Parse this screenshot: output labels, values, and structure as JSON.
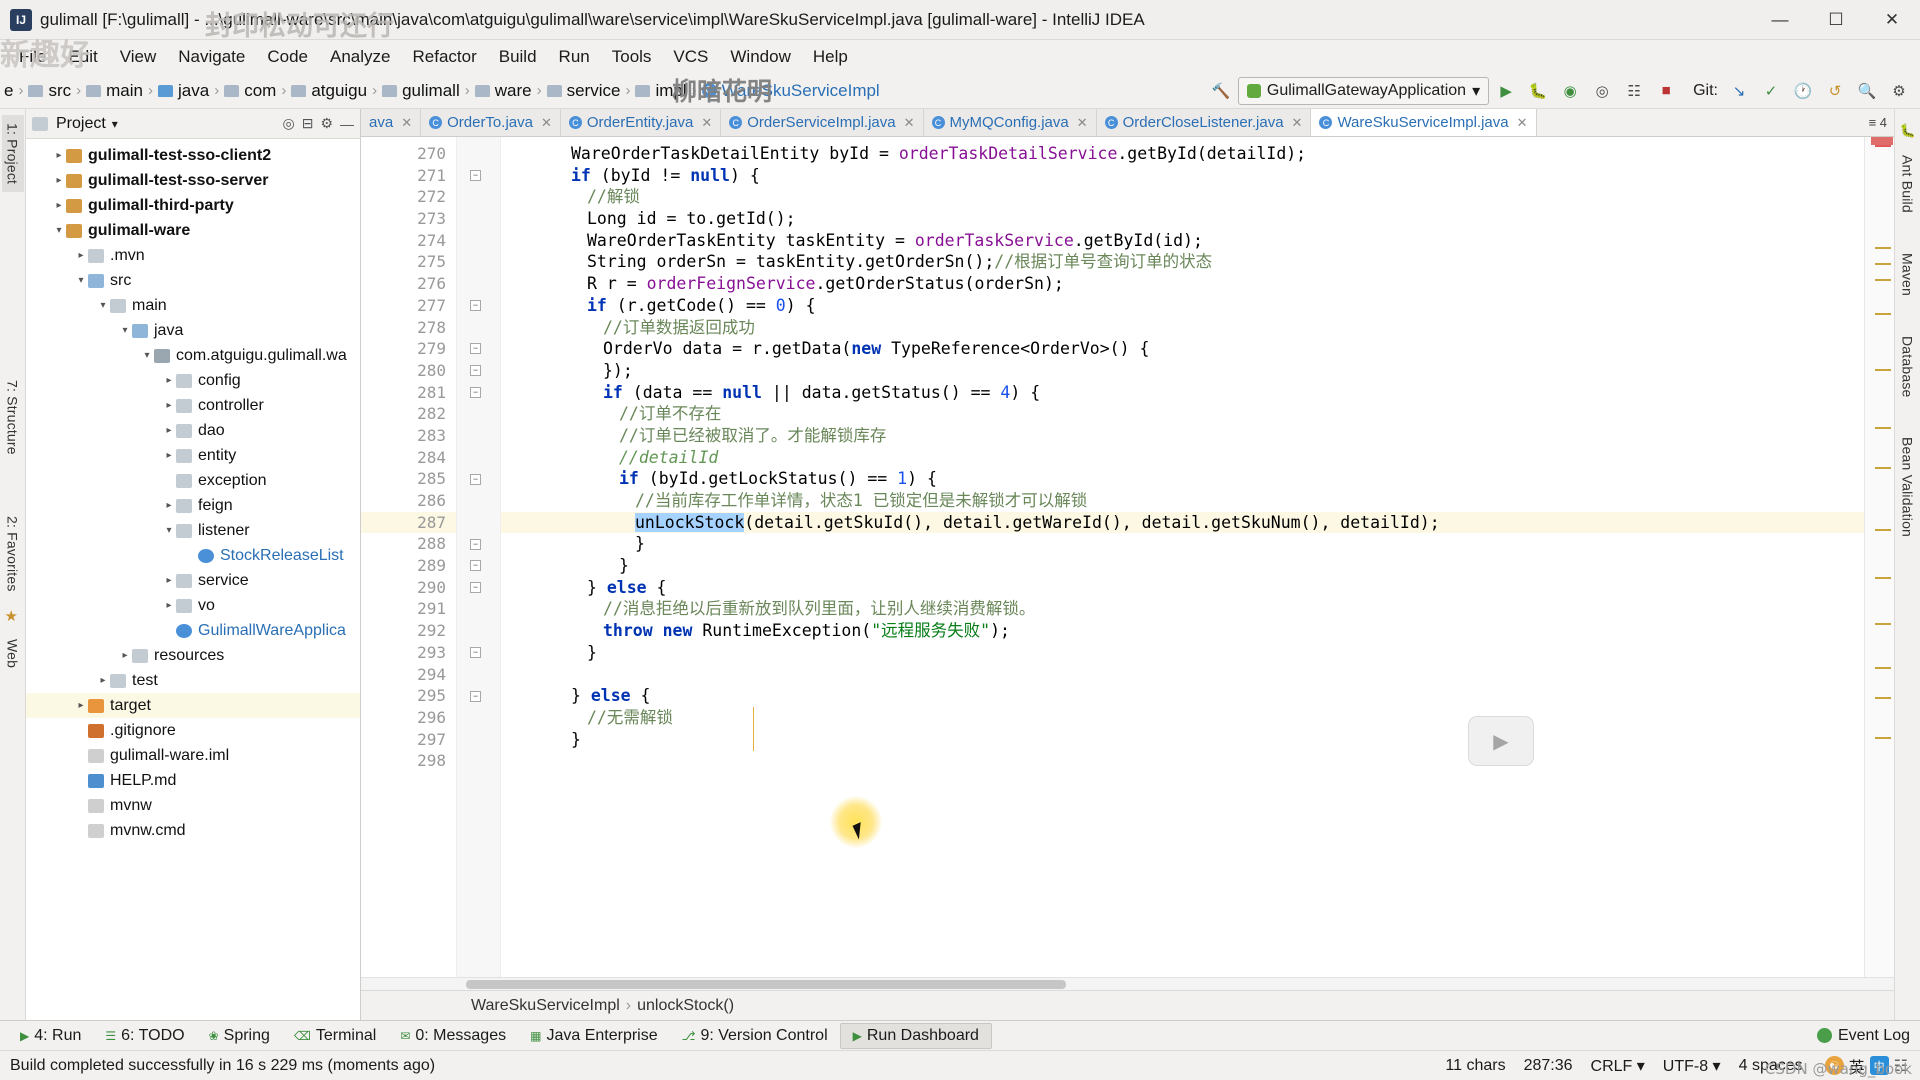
{
  "window": {
    "title": "gulimall [F:\\gulimall] - ...\\gulimall-ware\\src\\main\\java\\com\\atguigu\\gulimall\\ware\\service\\impl\\WareSkuServiceImpl.java [gulimall-ware] - IntelliJ IDEA",
    "app_icon": "IJ",
    "minimize": "—",
    "maximize": "☐",
    "close": "✕"
  },
  "menubar": [
    "File",
    "Edit",
    "View",
    "Navigate",
    "Code",
    "Analyze",
    "Refactor",
    "Build",
    "Run",
    "Tools",
    "VCS",
    "Window",
    "Help"
  ],
  "navbar": {
    "crumbs": [
      "e",
      "src",
      "main",
      "java",
      "com",
      "atguigu",
      "gulimall",
      "ware",
      "service",
      "impl",
      "WareSkuServiceImpl"
    ],
    "run_config": "GulimallGatewayApplication",
    "git_label": "Git:"
  },
  "project_panel": {
    "title": "Project",
    "tree": [
      {
        "indent": 1,
        "arrow": "›",
        "icon": "mod",
        "label": "gulimall-test-sso-client2",
        "bold": true,
        "selected": false
      },
      {
        "indent": 1,
        "arrow": "›",
        "icon": "mod",
        "label": "gulimall-test-sso-server",
        "bold": true,
        "selected": false
      },
      {
        "indent": 1,
        "arrow": "›",
        "icon": "mod",
        "label": "gulimall-third-party",
        "bold": true,
        "selected": false
      },
      {
        "indent": 1,
        "arrow": "⌄",
        "icon": "mod",
        "label": "gulimall-ware",
        "bold": true,
        "selected": false
      },
      {
        "indent": 2,
        "arrow": "›",
        "icon": "fold",
        "label": ".mvn",
        "bold": false,
        "selected": false
      },
      {
        "indent": 2,
        "arrow": "⌄",
        "icon": "src",
        "label": "src",
        "bold": false,
        "selected": false
      },
      {
        "indent": 3,
        "arrow": "⌄",
        "icon": "fold",
        "label": "main",
        "bold": false,
        "selected": false
      },
      {
        "indent": 4,
        "arrow": "⌄",
        "icon": "src",
        "label": "java",
        "bold": false,
        "selected": false
      },
      {
        "indent": 5,
        "arrow": "⌄",
        "icon": "pkg",
        "label": "com.atguigu.gulimall.wa",
        "bold": false,
        "selected": false
      },
      {
        "indent": 6,
        "arrow": "›",
        "icon": "fold",
        "label": "config",
        "bold": false,
        "selected": false
      },
      {
        "indent": 6,
        "arrow": "›",
        "icon": "fold",
        "label": "controller",
        "bold": false,
        "selected": false
      },
      {
        "indent": 6,
        "arrow": "›",
        "icon": "fold",
        "label": "dao",
        "bold": false,
        "selected": false
      },
      {
        "indent": 6,
        "arrow": "›",
        "icon": "fold",
        "label": "entity",
        "bold": false,
        "selected": false
      },
      {
        "indent": 6,
        "arrow": "",
        "icon": "fold",
        "label": "exception",
        "bold": false,
        "selected": false
      },
      {
        "indent": 6,
        "arrow": "›",
        "icon": "fold",
        "label": "feign",
        "bold": false,
        "selected": false
      },
      {
        "indent": 6,
        "arrow": "⌄",
        "icon": "fold",
        "label": "listener",
        "bold": false,
        "selected": false
      },
      {
        "indent": 7,
        "arrow": "",
        "icon": "java",
        "label": "StockReleaseList",
        "bold": false,
        "selected": false,
        "blue": true
      },
      {
        "indent": 6,
        "arrow": "›",
        "icon": "fold",
        "label": "service",
        "bold": false,
        "selected": false
      },
      {
        "indent": 6,
        "arrow": "›",
        "icon": "fold",
        "label": "vo",
        "bold": false,
        "selected": false
      },
      {
        "indent": 6,
        "arrow": "",
        "icon": "java",
        "label": "GulimallWareApplica",
        "bold": false,
        "selected": false,
        "blue": true
      },
      {
        "indent": 4,
        "arrow": "›",
        "icon": "fold",
        "label": "resources",
        "bold": false,
        "selected": false
      },
      {
        "indent": 3,
        "arrow": "›",
        "icon": "fold",
        "label": "test",
        "bold": false,
        "selected": false
      },
      {
        "indent": 2,
        "arrow": "›",
        "icon": "foldo",
        "label": "target",
        "bold": false,
        "selected": true
      },
      {
        "indent": 2,
        "arrow": "",
        "icon": "git",
        "label": ".gitignore",
        "bold": false,
        "selected": false
      },
      {
        "indent": 2,
        "arrow": "",
        "icon": "file",
        "label": "gulimall-ware.iml",
        "bold": false,
        "selected": false
      },
      {
        "indent": 2,
        "arrow": "",
        "icon": "md",
        "label": "HELP.md",
        "bold": false,
        "selected": false
      },
      {
        "indent": 2,
        "arrow": "",
        "icon": "file",
        "label": "mvnw",
        "bold": false,
        "selected": false
      },
      {
        "indent": 2,
        "arrow": "",
        "icon": "file",
        "label": "mvnw.cmd",
        "bold": false,
        "selected": false
      }
    ]
  },
  "left_strip": [
    "1: Project",
    "7: Structure",
    "2: Favorites",
    "Web"
  ],
  "right_strip": [
    "Ant Build",
    "Maven",
    "Database",
    "Bean Validation"
  ],
  "editor_tabs": [
    {
      "label": "ava",
      "active": false,
      "truncated": true
    },
    {
      "label": "OrderTo.java",
      "active": false
    },
    {
      "label": "OrderEntity.java",
      "active": false
    },
    {
      "label": "OrderServiceImpl.java",
      "active": false
    },
    {
      "label": "MyMQConfig.java",
      "active": false
    },
    {
      "label": "OrderCloseListener.java",
      "active": false
    },
    {
      "label": "WareSkuServiceImpl.java",
      "active": true
    }
  ],
  "code": {
    "first_line": 270,
    "lines": [
      {
        "n": 270,
        "indent": 4,
        "parts": [
          {
            "t": "WareOrderTaskDetailEntity byId = ",
            "c": ""
          },
          {
            "t": "orderTaskDetailService",
            "c": "fld"
          },
          {
            "t": ".getById(detailId);",
            "c": ""
          }
        ]
      },
      {
        "n": 271,
        "indent": 4,
        "fold": true,
        "parts": [
          {
            "t": "if",
            "c": "kw"
          },
          {
            "t": " (byId != ",
            "c": ""
          },
          {
            "t": "null",
            "c": "kw"
          },
          {
            "t": ") {",
            "c": ""
          }
        ]
      },
      {
        "n": 272,
        "indent": 5,
        "parts": [
          {
            "t": "//解锁",
            "c": "cm"
          }
        ]
      },
      {
        "n": 273,
        "indent": 5,
        "parts": [
          {
            "t": "Long id = to.getId();",
            "c": ""
          }
        ]
      },
      {
        "n": 274,
        "indent": 5,
        "parts": [
          {
            "t": "WareOrderTaskEntity taskEntity = ",
            "c": ""
          },
          {
            "t": "orderTaskService",
            "c": "fld"
          },
          {
            "t": ".getById(id);",
            "c": ""
          }
        ]
      },
      {
        "n": 275,
        "indent": 5,
        "parts": [
          {
            "t": "String orderSn = taskEntity.getOrderSn();",
            "c": ""
          },
          {
            "t": "//根据订单号查询订单的状态",
            "c": "cm"
          }
        ]
      },
      {
        "n": 276,
        "indent": 5,
        "parts": [
          {
            "t": "R r = ",
            "c": ""
          },
          {
            "t": "orderFeignService",
            "c": "fld"
          },
          {
            "t": ".getOrderStatus(orderSn);",
            "c": ""
          }
        ]
      },
      {
        "n": 277,
        "indent": 5,
        "fold": true,
        "parts": [
          {
            "t": "if",
            "c": "kw"
          },
          {
            "t": " (r.getCode() == ",
            "c": ""
          },
          {
            "t": "0",
            "c": "num"
          },
          {
            "t": ") {",
            "c": ""
          }
        ]
      },
      {
        "n": 278,
        "indent": 6,
        "parts": [
          {
            "t": "//订单数据返回成功",
            "c": "cm"
          }
        ]
      },
      {
        "n": 279,
        "indent": 6,
        "fold": true,
        "parts": [
          {
            "t": "OrderVo data = r.getData(",
            "c": ""
          },
          {
            "t": "new",
            "c": "kw"
          },
          {
            "t": " TypeReference<OrderVo>() {",
            "c": ""
          }
        ]
      },
      {
        "n": 280,
        "indent": 6,
        "fold": true,
        "parts": [
          {
            "t": "});",
            "c": ""
          }
        ]
      },
      {
        "n": 281,
        "indent": 6,
        "fold": true,
        "parts": [
          {
            "t": "if",
            "c": "kw"
          },
          {
            "t": " (data == ",
            "c": ""
          },
          {
            "t": "null",
            "c": "kw"
          },
          {
            "t": " || data.getStatus() == ",
            "c": ""
          },
          {
            "t": "4",
            "c": "num"
          },
          {
            "t": ") {",
            "c": ""
          }
        ]
      },
      {
        "n": 282,
        "indent": 7,
        "parts": [
          {
            "t": "//订单不存在",
            "c": "cm"
          }
        ]
      },
      {
        "n": 283,
        "indent": 7,
        "parts": [
          {
            "t": "//订单已经被取消了。才能解锁库存",
            "c": "cm"
          }
        ]
      },
      {
        "n": 284,
        "indent": 7,
        "parts": [
          {
            "t": "//detailId",
            "c": "cm2"
          }
        ]
      },
      {
        "n": 285,
        "indent": 7,
        "fold": true,
        "parts": [
          {
            "t": "if",
            "c": "kw"
          },
          {
            "t": " (byId.getLockStatus() == ",
            "c": ""
          },
          {
            "t": "1",
            "c": "num"
          },
          {
            "t": ") {",
            "c": ""
          }
        ]
      },
      {
        "n": 286,
        "indent": 8,
        "parts": [
          {
            "t": "//当前库存工作单详情，状态1 已锁定但是未解锁才可以解锁",
            "c": "cm"
          }
        ]
      },
      {
        "n": 287,
        "indent": 8,
        "highlight": true,
        "bulb": true,
        "parts": [
          {
            "t": "unLockStock",
            "c": "sel"
          },
          {
            "t": "(detail.getSkuId(), detail.getWareId(), detail.getSkuNum(), detailId);",
            "c": ""
          }
        ]
      },
      {
        "n": 288,
        "indent": 8,
        "fold": true,
        "parts": [
          {
            "t": "}",
            "c": ""
          }
        ]
      },
      {
        "n": 289,
        "indent": 7,
        "fold": true,
        "parts": [
          {
            "t": "}",
            "c": ""
          }
        ]
      },
      {
        "n": 290,
        "indent": 5,
        "fold": true,
        "parts": [
          {
            "t": "} ",
            "c": ""
          },
          {
            "t": "else",
            "c": "kw"
          },
          {
            "t": " {",
            "c": ""
          }
        ]
      },
      {
        "n": 291,
        "indent": 6,
        "parts": [
          {
            "t": "//消息拒绝以后重新放到队列里面，让别人继续消费解锁。",
            "c": "cm"
          }
        ]
      },
      {
        "n": 292,
        "indent": 6,
        "parts": [
          {
            "t": "throw",
            "c": "kw"
          },
          {
            "t": " ",
            "c": ""
          },
          {
            "t": "new",
            "c": "kw"
          },
          {
            "t": " RuntimeException(",
            "c": ""
          },
          {
            "t": "\"远程服务失败\"",
            "c": "str"
          },
          {
            "t": ");",
            "c": ""
          }
        ]
      },
      {
        "n": 293,
        "indent": 5,
        "fold": true,
        "parts": [
          {
            "t": "}",
            "c": ""
          }
        ]
      },
      {
        "n": 294,
        "indent": 4,
        "parts": [
          {
            "t": "",
            "c": ""
          }
        ]
      },
      {
        "n": 295,
        "indent": 4,
        "fold": true,
        "parts": [
          {
            "t": "} ",
            "c": ""
          },
          {
            "t": "else",
            "c": "kw"
          },
          {
            "t": " {",
            "c": ""
          }
        ]
      },
      {
        "n": 296,
        "indent": 5,
        "parts": [
          {
            "t": "//无需解锁",
            "c": "cm"
          }
        ]
      },
      {
        "n": 297,
        "indent": 4,
        "parts": [
          {
            "t": "}",
            "c": ""
          }
        ]
      },
      {
        "n": 298,
        "indent": 4,
        "parts": [
          {
            "t": "",
            "c": ""
          }
        ]
      }
    ]
  },
  "editor_breadcrumb": [
    "WareSkuServiceImpl",
    "unlockStock()"
  ],
  "tool_window_bar": {
    "items": [
      {
        "label": "4: Run",
        "icon": "play",
        "highlight": false
      },
      {
        "label": "6: TODO",
        "icon": "list",
        "highlight": false
      },
      {
        "label": "Spring",
        "icon": "leaf",
        "highlight": false
      },
      {
        "label": "Terminal",
        "icon": "term",
        "highlight": false
      },
      {
        "label": "0: Messages",
        "icon": "msg",
        "highlight": false
      },
      {
        "label": "Java Enterprise",
        "icon": "jee",
        "highlight": false
      },
      {
        "label": "9: Version Control",
        "icon": "vcs",
        "highlight": false
      },
      {
        "label": "Run Dashboard",
        "icon": "play",
        "highlight": true
      }
    ],
    "event_log": "Event Log"
  },
  "statusbar": {
    "message": "Build completed successfully in 16 s 229 ms (moments ago)",
    "chars": "11 chars",
    "caret": "287:36",
    "line_sep": "CRLF",
    "encoding": "UTF-8",
    "indent": "4 spaces",
    "ime_cn": "英",
    "ime_mark": "中"
  },
  "watermarks": {
    "top1": "封印松动可还行",
    "top2": "新趣好",
    "top3": "柳暗花明",
    "credit": "CSDN @wang_book"
  },
  "colors": {
    "accent": "#2a6fb5",
    "selection": "#a6d2ff",
    "highlight_line": "#fcf8e3",
    "green": "#62a93f",
    "comment": "#6a8759",
    "keyword": "#0033b3",
    "string": "#067d17",
    "number": "#1750eb"
  }
}
